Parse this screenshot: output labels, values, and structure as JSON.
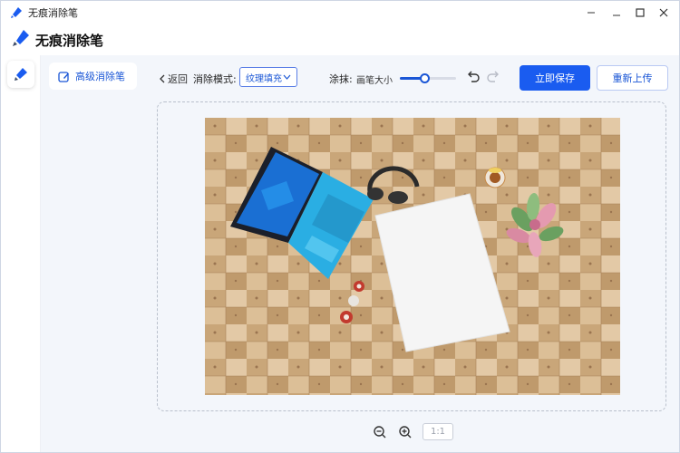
{
  "window": {
    "title": "无痕消除笔",
    "controls": [
      "minimize",
      "restore-small",
      "maximize",
      "close"
    ]
  },
  "app": {
    "title": "无痕消除笔",
    "icon": "brush-icon"
  },
  "rail": {
    "items": [
      {
        "icon": "brush-icon",
        "active": true
      }
    ]
  },
  "sidebar": {
    "items": [
      {
        "label": "高级消除笔",
        "icon": "edit-icon",
        "active": true
      }
    ]
  },
  "toolbar": {
    "back_label": "返回",
    "mode_label": "消除模式:",
    "mode_value": "纹理填充",
    "brush_label": "涂抹:",
    "brush_size_label": "画笔大小",
    "brush_size_level": 0.45,
    "save_label": "立即保存",
    "reupload_label": "重新上传"
  },
  "zoom": {
    "ratio_label": "1:1"
  },
  "colors": {
    "accent": "#1a5cf0",
    "canvas_bg": "#f3f6fb",
    "wood_light": "#d9bd98",
    "wood_dark": "#a87e58"
  }
}
